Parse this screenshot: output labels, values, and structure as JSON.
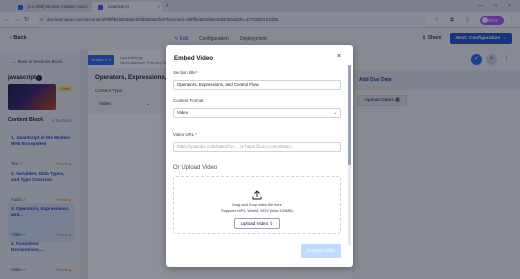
{
  "browser": {
    "tabs": [
      {
        "label": "[LU-295] Section creation mod...",
        "active": false
      },
      {
        "label": "LearnUp AI",
        "active": true
      }
    ],
    "url": "dev.learnupai.com/v2/content/6f9ff94580d6be93fd006a82feb?lessonId=6f9ff94580d6be93fd006a82fe=1772093102338",
    "profile_label": "Work"
  },
  "header": {
    "back_label": "Back",
    "tabs": [
      "Edit",
      "Configuration",
      "Deployment"
    ],
    "share_label": "Share",
    "next_label": "Next: Configuration →"
  },
  "sidebar": {
    "back_to_sections": "Back to Sections Block",
    "course_title": "javascript",
    "info": "i",
    "draft": "Draft",
    "content_block_label": "Content Block",
    "section_count": "4 Sections",
    "sections": [
      {
        "title": "1. JavaScript in the Modern Web Ecosystem",
        "meta": "Text ✓",
        "status": "Pending"
      },
      {
        "title": "2. Variables, Data Types, and Type Coercion",
        "meta": "Audio ✓",
        "status": "Pending"
      },
      {
        "title": "3. Operators, Expressions, and...",
        "meta": "Video ✓",
        "status": "Pending"
      },
      {
        "title": "4. Functions: Declarations,...",
        "meta": "Video ✓",
        "status": "Pending"
      }
    ]
  },
  "main": {
    "version_label": "Version 1 ▾",
    "last_edited_line1": "Last edited by",
    "last_edited_line2": "Name lastname, February 26",
    "section_title": "Operators, Expressions, and Control Flow",
    "content_type_label": "Content Type",
    "content_type_value": "Video"
  },
  "right_panel": {
    "due_label": "Add Due Date",
    "update_label": "Update Dates"
  },
  "modal": {
    "title": "Embed Video",
    "close": "×",
    "section_title_label": "Section title",
    "section_title_value": "Operators, Expressions, and Control Flow",
    "content_format_label": "Content Format",
    "content_format_value": "Video",
    "video_url_label": "Video URL",
    "video_url_placeholder": "https://youtube.com/watch?v=... or https://loom.com/share/...",
    "or_upload": "Or Upload Video",
    "dz_line1": "Drag and Drop video file here",
    "dz_line2": "Supports MP4, WebM, MOV (Max 100MB)",
    "upload_button": "Upload Video",
    "embed_button": "Embed Video",
    "required_mark": "*"
  },
  "colors": {
    "accent": "#1d4ed8",
    "pending": "#d97706",
    "embed_disabled": "#bfdbfe"
  }
}
